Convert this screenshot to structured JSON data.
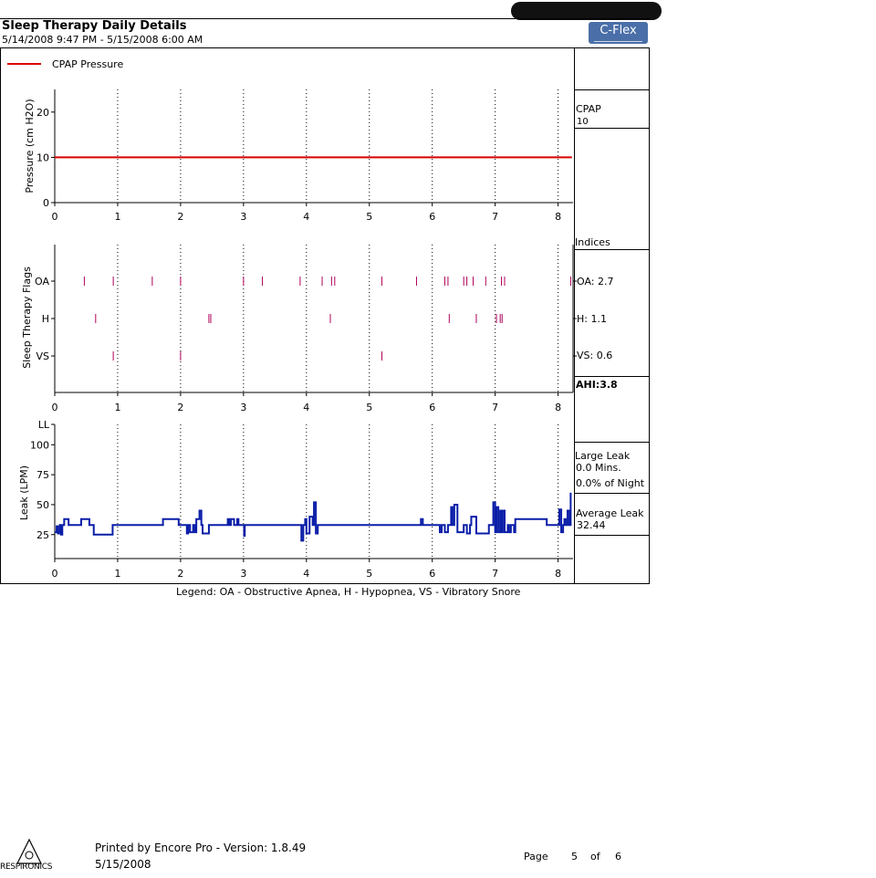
{
  "header": {
    "title": "Sleep Therapy Daily Details",
    "date_range": "5/14/2008 9:47 PM - 5/15/2008 6:00 AM",
    "badge": "C-Flex"
  },
  "legend": {
    "series_label": "CPAP Pressure",
    "bottom_legend": "Legend: OA - Obstructive Apnea, H - Hypopnea, VS - Vibratory Snore"
  },
  "side_panel": {
    "cpap_label": "CPAP",
    "cpap_value": "10",
    "indices_label": "Indices",
    "oa_index": "OA: 2.7",
    "h_index": "H: 1.1",
    "vs_index": "VS: 0.6",
    "ahi": "AHI:3.8",
    "large_leak_label": "Large Leak",
    "large_leak_mins": "0.0 Mins.",
    "large_leak_pct": "0.0% of Night",
    "average_leak_label": "Average Leak",
    "average_leak_value": "32.44"
  },
  "footer": {
    "printed_by": "Printed by Encore Pro - Version: 1.8.49",
    "print_date": "5/15/2008",
    "page_label": "Page",
    "page_num": "5",
    "of_label": "of",
    "page_total": "6",
    "logo_text": "RESPIRONICS"
  },
  "colors": {
    "pressure": "#d90000",
    "flags": "#b0005a",
    "leak": "#0a1ea8",
    "badge": "#4a6fa8"
  },
  "chart_data": [
    {
      "type": "line",
      "ylabel": "Pressure (cm H2O)",
      "xlim": [
        0,
        8.22
      ],
      "ylim": [
        0,
        25
      ],
      "x_ticks": [
        "0",
        "1",
        "2",
        "3",
        "4",
        "5",
        "6",
        "7",
        "8"
      ],
      "y_ticks": [
        "0",
        "10",
        "20"
      ],
      "grid": "vertical dotted",
      "legend": "top-left",
      "series": [
        {
          "name": "CPAP Pressure",
          "x": [
            0,
            8.22
          ],
          "y": [
            10,
            10
          ]
        }
      ]
    },
    {
      "type": "scatter",
      "ylabel": "Sleep Therapy Flags",
      "xlim": [
        0,
        8.22
      ],
      "x_ticks": [
        "0",
        "1",
        "2",
        "3",
        "4",
        "5",
        "6",
        "7",
        "8"
      ],
      "categories": [
        "OA",
        "H",
        "VS"
      ],
      "series": [
        {
          "name": "OA",
          "x": [
            0.47,
            0.93,
            1.55,
            2.0,
            3.0,
            3.3,
            3.9,
            4.25,
            4.4,
            4.45,
            5.2,
            5.75,
            6.2,
            6.25,
            6.5,
            6.55,
            6.65,
            6.85,
            7.1,
            7.15,
            8.2
          ]
        },
        {
          "name": "H",
          "x": [
            0.65,
            2.45,
            2.48,
            4.38,
            6.27,
            6.7,
            7.02,
            7.08,
            7.11
          ]
        },
        {
          "name": "VS",
          "x": [
            0.93,
            2.0,
            5.2
          ]
        }
      ]
    },
    {
      "type": "line",
      "ylabel": "Leak (LPM)",
      "xlim": [
        0,
        8.22
      ],
      "ylim": [
        5,
        117
      ],
      "x_ticks": [
        "0",
        "1",
        "2",
        "3",
        "4",
        "5",
        "6",
        "7",
        "8"
      ],
      "y_ticks": [
        "25",
        "50",
        "75",
        "100",
        "LL"
      ],
      "grid": "vertical dotted",
      "series": [
        {
          "name": "Leak",
          "x": [
            0,
            0.03,
            0.05,
            0.08,
            0.1,
            0.12,
            0.15,
            0.2,
            0.22,
            0.25,
            0.4,
            0.42,
            0.45,
            0.55,
            0.6,
            0.62,
            0.65,
            0.9,
            0.92,
            1.7,
            1.72,
            1.95,
            1.97,
            2.1,
            2.12,
            2.15,
            2.2,
            2.23,
            2.25,
            2.3,
            2.33,
            2.35,
            2.4,
            2.45,
            2.5,
            2.52,
            2.7,
            2.75,
            2.77,
            2.8,
            2.85,
            2.9,
            2.92,
            2.95,
            3.0,
            3.01,
            3.02,
            3.05,
            3.9,
            3.92,
            3.95,
            3.98,
            4.0,
            4.05,
            4.1,
            4.12,
            4.15,
            4.18,
            4.2,
            5.8,
            5.82,
            5.85,
            5.9,
            6.1,
            6.12,
            6.15,
            6.2,
            6.25,
            6.3,
            6.32,
            6.35,
            6.4,
            6.5,
            6.55,
            6.6,
            6.62,
            6.7,
            6.9,
            6.95,
            6.97,
            7.0,
            7.02,
            7.05,
            7.08,
            7.1,
            7.12,
            7.15,
            7.2,
            7.22,
            7.25,
            7.3,
            7.32,
            7.8,
            7.82,
            8.0,
            8.02,
            8.05,
            8.08,
            8.1,
            8.12,
            8.15,
            8.18,
            8.2
          ],
          "y": [
            27,
            32,
            26,
            33,
            25,
            33,
            38,
            38,
            33,
            33,
            33,
            38,
            38,
            33,
            33,
            25,
            25,
            25,
            33,
            33,
            38,
            38,
            33,
            26,
            33,
            27,
            33,
            27,
            38,
            45,
            33,
            26,
            26,
            33,
            33,
            33,
            33,
            38,
            33,
            38,
            33,
            38,
            33,
            33,
            33,
            24,
            33,
            33,
            33,
            20,
            33,
            38,
            26,
            40,
            33,
            52,
            26,
            33,
            33,
            33,
            38,
            33,
            33,
            33,
            27,
            33,
            27,
            33,
            48,
            33,
            50,
            27,
            33,
            26,
            33,
            40,
            26,
            33,
            33,
            52,
            27,
            48,
            27,
            45,
            27,
            45,
            27,
            33,
            27,
            33,
            27,
            38,
            38,
            33,
            33,
            46,
            27,
            33,
            38,
            33,
            45,
            33,
            60
          ]
        }
      ]
    }
  ]
}
